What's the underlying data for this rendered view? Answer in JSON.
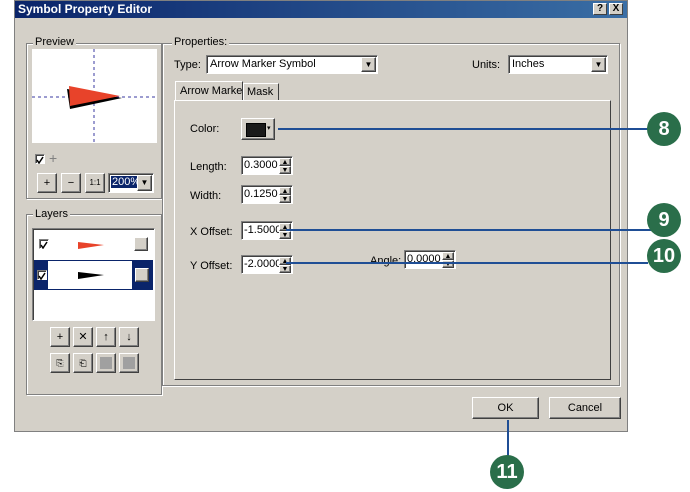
{
  "window": {
    "title": "Symbol Property Editor",
    "help_btn": "?",
    "close_btn": "X"
  },
  "preview": {
    "label": "Preview",
    "zoom": "200%"
  },
  "layers": {
    "label": "Layers"
  },
  "properties": {
    "label": "Properties:",
    "type_label": "Type:",
    "type_value": "Arrow Marker Symbol",
    "units_label": "Units:",
    "units_value": "Inches",
    "tabs": [
      "Arrow Marker",
      "Mask"
    ],
    "color_label": "Color:",
    "length_label": "Length:",
    "length_value": "0.3000",
    "width_label": "Width:",
    "width_value": "0.1250",
    "xoffset_label": "X Offset:",
    "xoffset_value": "-1.5000",
    "yoffset_label": "Y Offset:",
    "yoffset_value": "-2.0000",
    "angle_label": "Angle:",
    "angle_value": "0.0000"
  },
  "buttons": {
    "ok": "OK",
    "cancel": "Cancel"
  },
  "callouts": [
    "8",
    "9",
    "10",
    "11"
  ],
  "colors": {
    "arrow_red": "#e8432a",
    "callout_green": "#2a6e4a",
    "callout_line": "#1f4e95",
    "selection_blue": "#0a246a"
  }
}
